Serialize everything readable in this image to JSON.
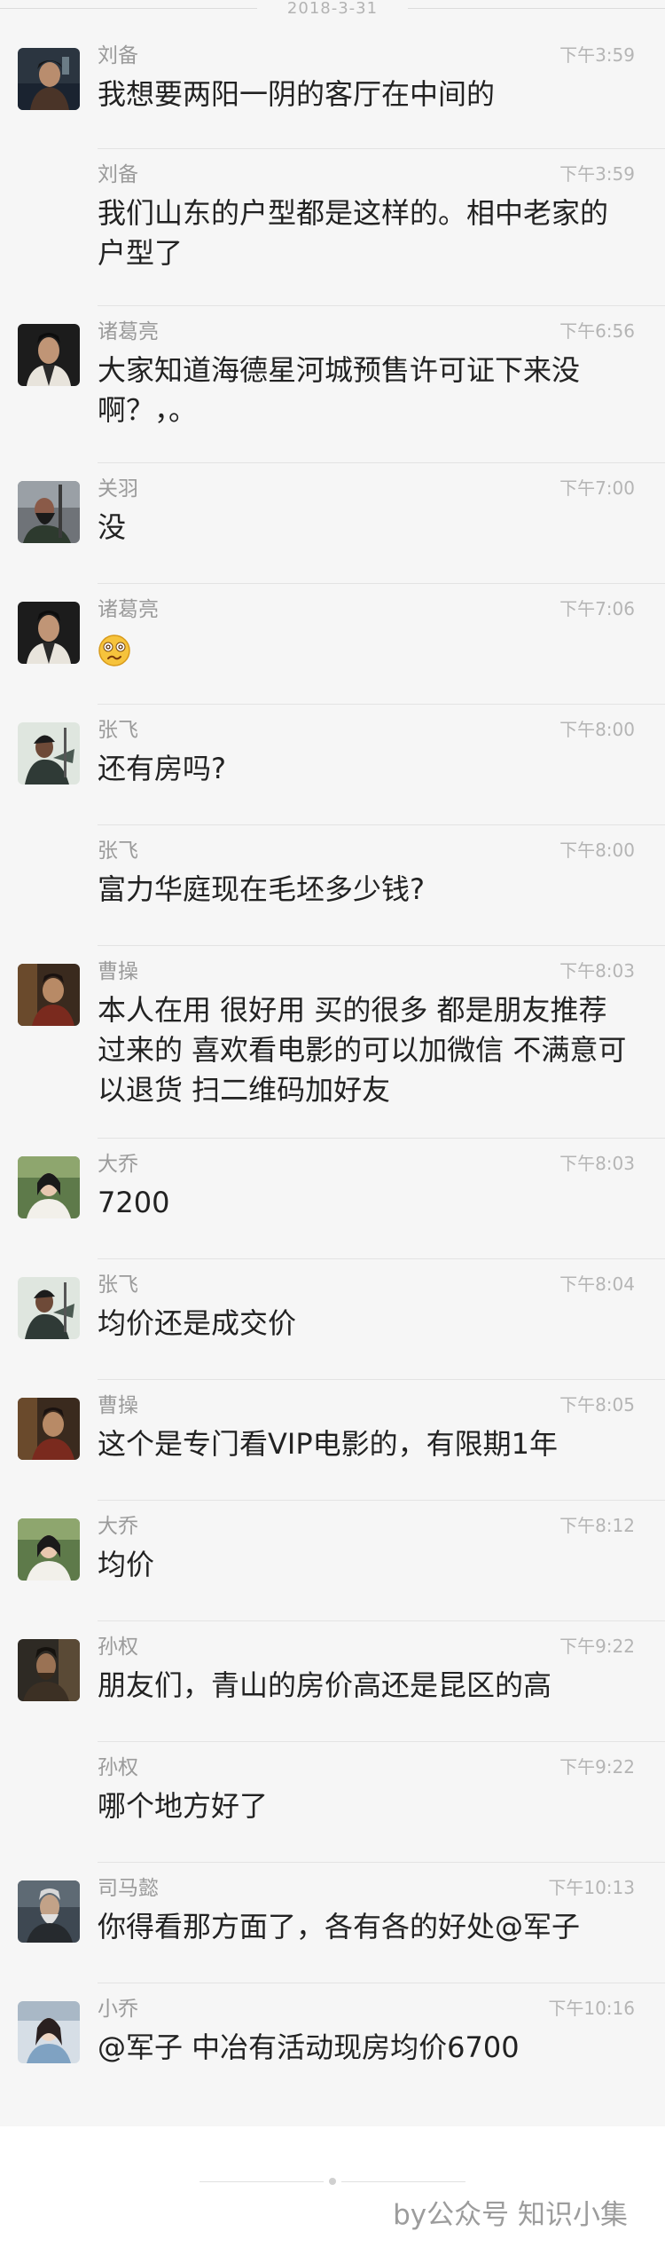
{
  "date_label": "2018-3-31",
  "messages": [
    {
      "name": "刘备",
      "time": "下午3:59",
      "text": "我想要两阳一阴的客厅在中间的",
      "avatar": "liubei-avatar",
      "show_avatar": true
    },
    {
      "name": "刘备",
      "time": "下午3:59",
      "text": "我们山东的户型都是这样的。相中老家的户型了",
      "avatar": "liubei-avatar",
      "show_avatar": false
    },
    {
      "name": "诸葛亮",
      "time": "下午6:56",
      "text": "大家知道海德星河城预售许可证下来没啊？，。",
      "avatar": "zhugeliang-avatar",
      "show_avatar": true
    },
    {
      "name": "关羽",
      "time": "下午7:00",
      "text": "没",
      "avatar": "guanyu-avatar",
      "show_avatar": true
    },
    {
      "name": "诸葛亮",
      "time": "下午7:06",
      "text": "",
      "emoji": "confused-face-emoji",
      "avatar": "zhugeliang-avatar",
      "show_avatar": true
    },
    {
      "name": "张飞",
      "time": "下午8:00",
      "text": "还有房吗?",
      "avatar": "zhangfei-avatar",
      "show_avatar": true
    },
    {
      "name": "张飞",
      "time": "下午8:00",
      "text": "富力华庭现在毛坯多少钱?",
      "avatar": "zhangfei-avatar",
      "show_avatar": false
    },
    {
      "name": "曹操",
      "time": "下午8:03",
      "text": "本人在用  很好用   买的很多  都是朋友推荐过来的  喜欢看电影的可以加微信  不满意可以退货 扫二维码加好友",
      "avatar": "caocao-avatar",
      "show_avatar": true
    },
    {
      "name": "大乔",
      "time": "下午8:03",
      "text": "7200",
      "avatar": "daqiao-avatar",
      "show_avatar": true
    },
    {
      "name": "张飞",
      "time": "下午8:04",
      "text": "均价还是成交价",
      "avatar": "zhangfei-avatar",
      "show_avatar": true
    },
    {
      "name": "曹操",
      "time": "下午8:05",
      "text": "这个是专门看VIP电影的，有限期1年",
      "avatar": "caocao-avatar",
      "show_avatar": true
    },
    {
      "name": "大乔",
      "time": "下午8:12",
      "text": "均价",
      "avatar": "daqiao-avatar",
      "show_avatar": true
    },
    {
      "name": "孙权",
      "time": "下午9:22",
      "text": "朋友们，青山的房价高还是昆区的高",
      "avatar": "sunquan-avatar",
      "show_avatar": true
    },
    {
      "name": "孙权",
      "time": "下午9:22",
      "text": "哪个地方好了",
      "avatar": "sunquan-avatar",
      "show_avatar": false
    },
    {
      "name": "司马懿",
      "time": "下午10:13",
      "text": "你得看那方面了，各有各的好处@军子",
      "avatar": "simayi-avatar",
      "show_avatar": true
    },
    {
      "name": "小乔",
      "time": "下午10:16",
      "text": "@军子 中冶有活动现房均价6700",
      "avatar": "xiaoqiao-avatar",
      "show_avatar": true
    }
  ],
  "watermark": "by公众号 知识小集",
  "colors": {
    "background": "#f6f6f6",
    "name_text": "#9b9b9b",
    "time_text": "#b5b5b5",
    "message_text": "#222222",
    "divider": "#e3e3e3"
  }
}
